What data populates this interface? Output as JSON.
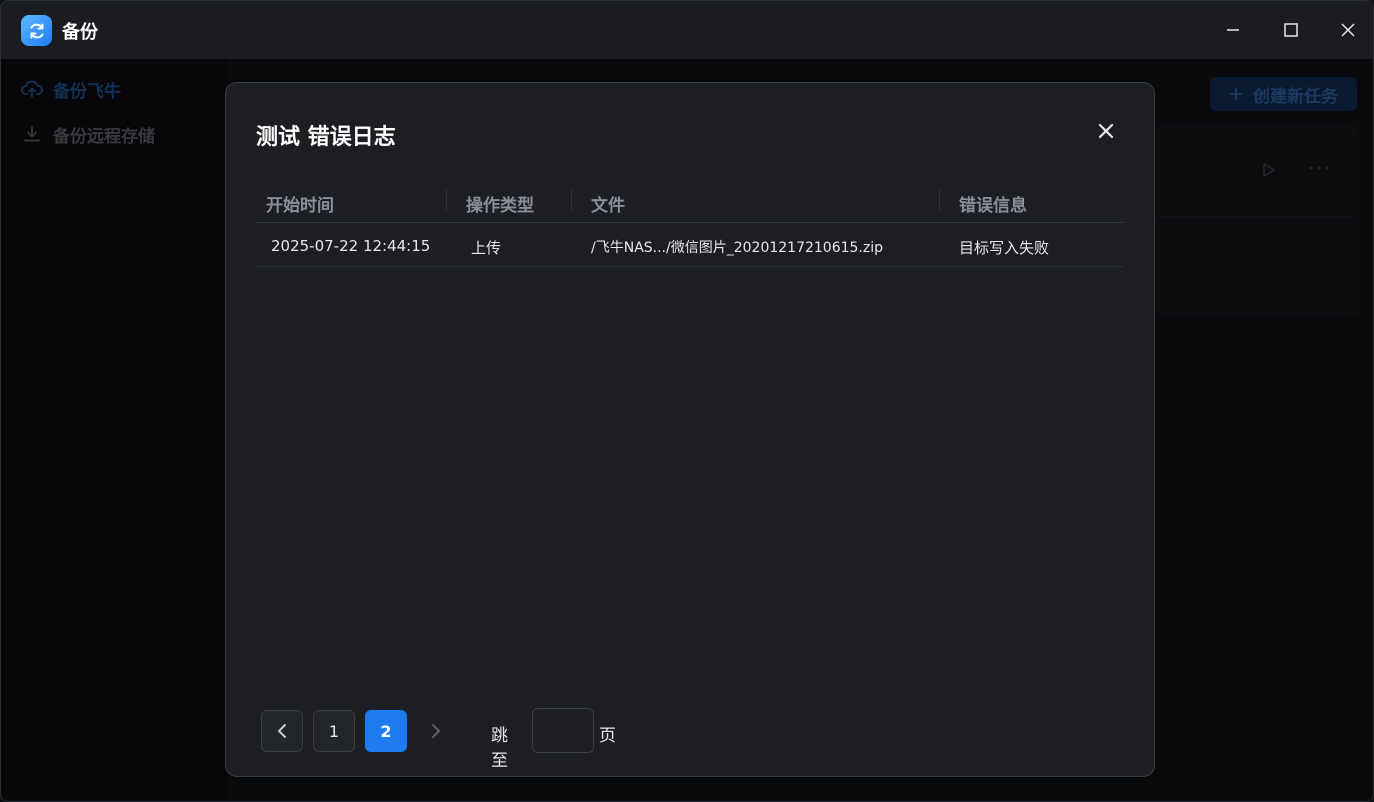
{
  "app": {
    "title": "备份"
  },
  "sidebar": {
    "items": [
      {
        "label": "备份飞牛",
        "icon": "cloud-upload-icon",
        "active": true
      },
      {
        "label": "备份远程存储",
        "icon": "download-icon",
        "active": false
      }
    ]
  },
  "main": {
    "create_button_label": "创建新任务"
  },
  "dialog": {
    "title": "测试 错误日志",
    "columns": [
      "开始时间",
      "操作类型",
      "文件",
      "错误信息"
    ],
    "rows": [
      {
        "start_time": "2025-07-22 12:44:15",
        "operation": "上传",
        "file": "/飞牛NAS.../微信图片_20201217210615.zip",
        "error": "目标写入失败"
      }
    ],
    "pagination": {
      "pages": [
        "1",
        "2"
      ],
      "current_page": "2",
      "jump_label": "跳至",
      "jump_value": "",
      "page_suffix": "页"
    }
  },
  "colors": {
    "accent": "#1e7cf2",
    "dialog_bg": "#1c1e23",
    "window_bg": "#16181d"
  }
}
